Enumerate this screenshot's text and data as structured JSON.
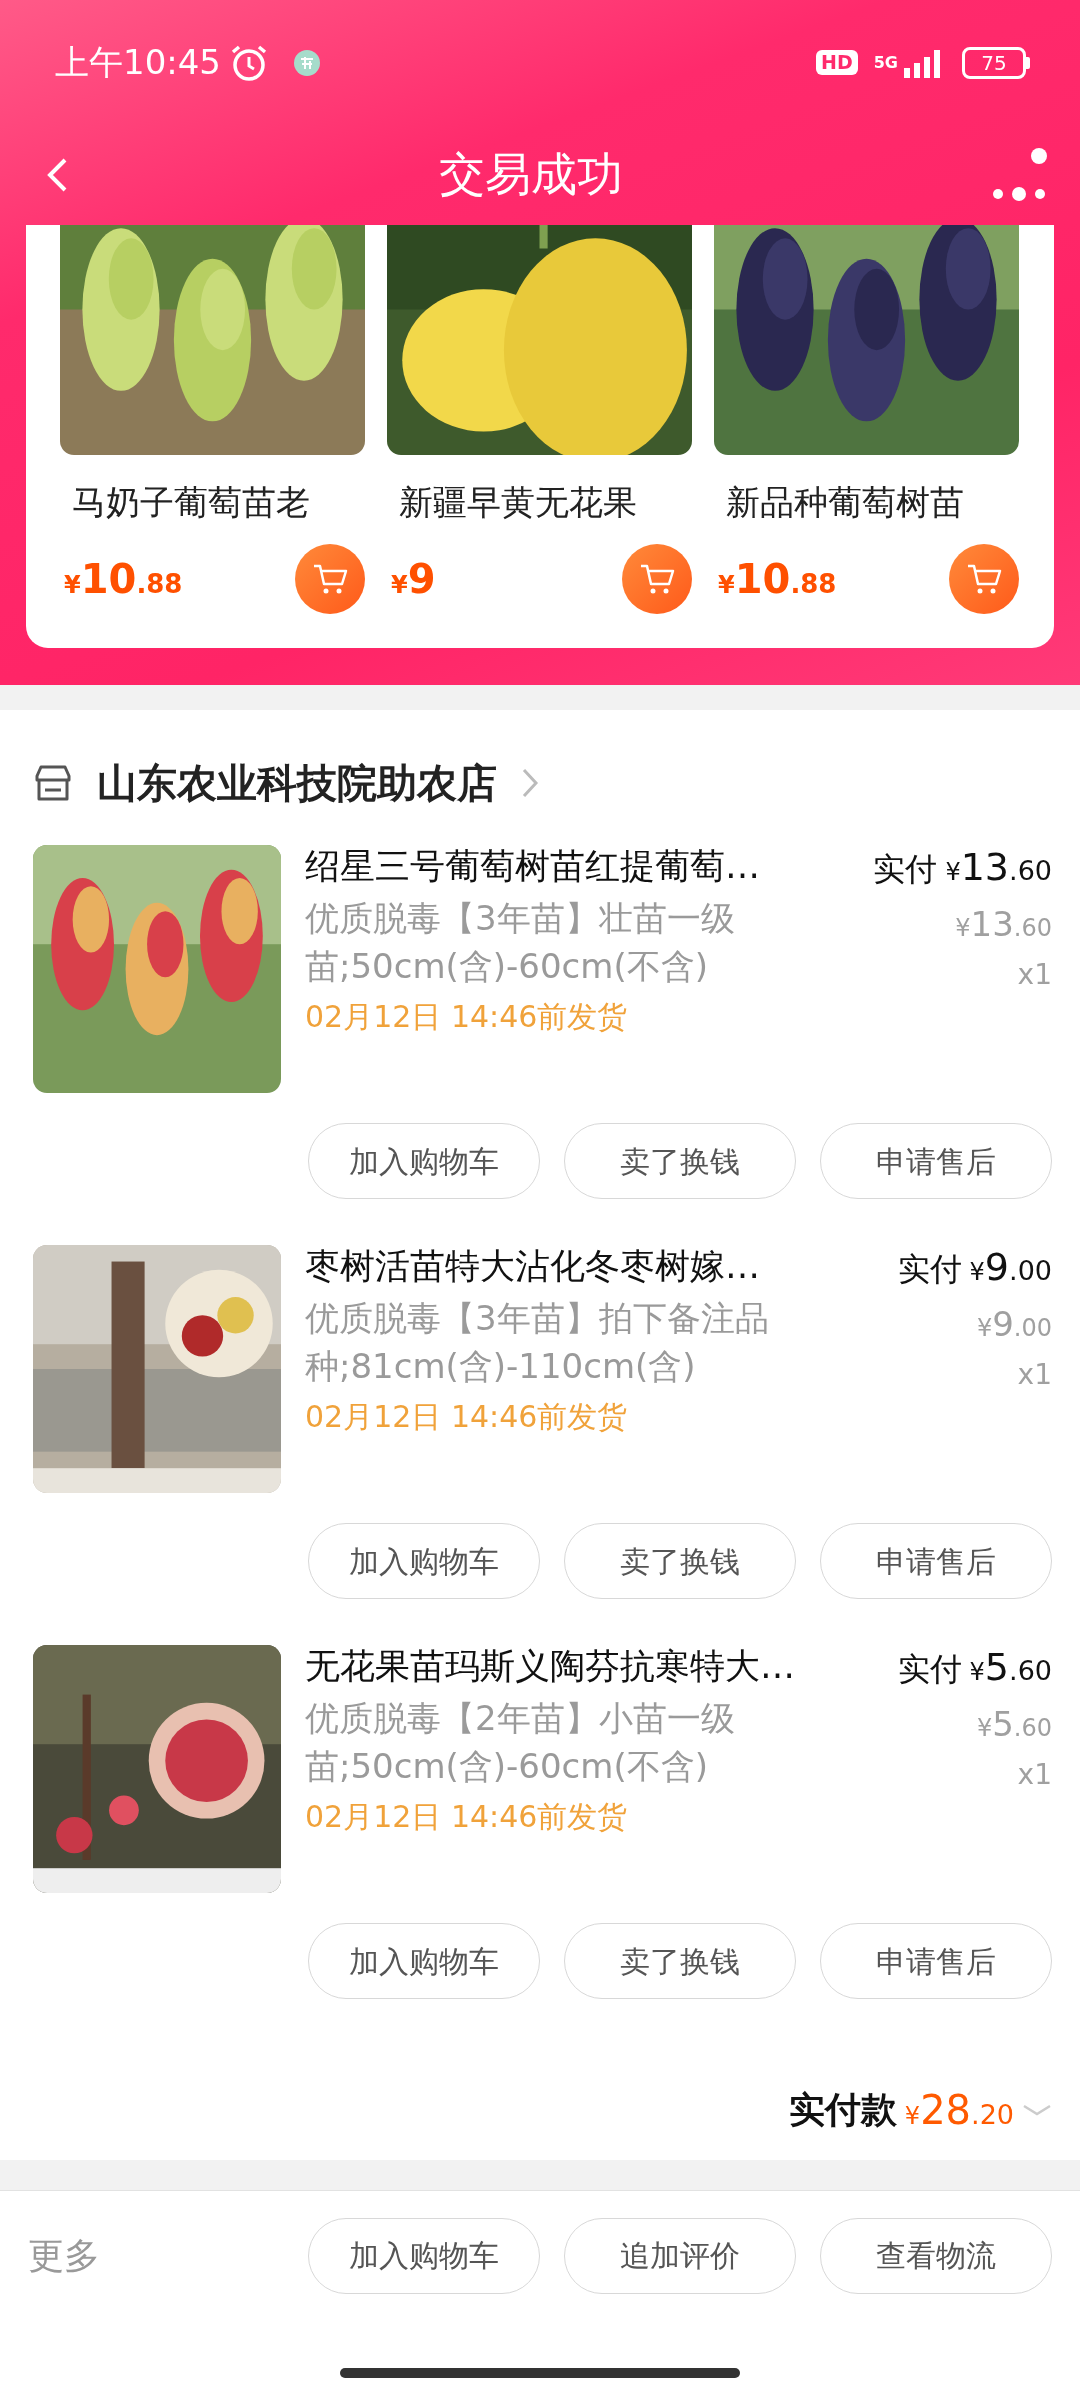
{
  "status_bar": {
    "time": "上午10:45",
    "hd": "HD",
    "network": "5G",
    "battery": "75"
  },
  "header": {
    "title": "交易成功"
  },
  "recommendations": [
    {
      "name": "马奶子葡萄苗老",
      "price": {
        "currency": "¥",
        "amount": "10",
        "fraction": ".88"
      }
    },
    {
      "name": "新疆早黄无花果",
      "price": {
        "currency": "¥",
        "amount": "9"
      }
    },
    {
      "name": "新品种葡萄树苗",
      "price": {
        "currency": "¥",
        "amount": "10",
        "fraction": ".88"
      }
    }
  ],
  "store": {
    "name": "山东农业科技院助农店"
  },
  "orders": [
    {
      "title": "绍星三号葡萄树苗红提葡萄…",
      "paid_label": "实付",
      "paid_price": {
        "currency": "¥",
        "amount": "13",
        "fraction": ".60"
      },
      "unit_price": {
        "currency": "¥",
        "amount": "13",
        "fraction": ".60"
      },
      "quantity": "x1",
      "spec": "优质脱毒【3年苗】壮苗一级苗;50cm(含)-60cm(不含)",
      "shipping": "02月12日 14:46前发货",
      "actions": [
        "加入购物车",
        "卖了换钱",
        "申请售后"
      ]
    },
    {
      "title": "枣树活苗特大沾化冬枣树嫁…",
      "paid_label": "实付",
      "paid_price": {
        "currency": "¥",
        "amount": "9",
        "fraction": ".00"
      },
      "unit_price": {
        "currency": "¥",
        "amount": "9",
        "fraction": ".00"
      },
      "quantity": "x1",
      "spec": "优质脱毒【3年苗】拍下备注品种;81cm(含)-110cm(含)",
      "shipping": "02月12日 14:46前发货",
      "actions": [
        "加入购物车",
        "卖了换钱",
        "申请售后"
      ]
    },
    {
      "title": "无花果苗玛斯义陶芬抗寒特大…",
      "paid_label": "实付",
      "paid_price": {
        "currency": "¥",
        "amount": "5",
        "fraction": ".60"
      },
      "unit_price": {
        "currency": "¥",
        "amount": "5",
        "fraction": ".60"
      },
      "quantity": "x1",
      "spec": "优质脱毒【2年苗】小苗一级苗;50cm(含)-60cm(不含)",
      "shipping": "02月12日 14:46前发货",
      "actions": [
        "加入购物车",
        "卖了换钱",
        "申请售后"
      ]
    }
  ],
  "total": {
    "label": "实付款",
    "price": {
      "currency": "¥",
      "amount": "28",
      "fraction": ".20"
    }
  },
  "bottom_bar": {
    "more": "更多",
    "actions": [
      "加入购物车",
      "追加评价",
      "查看物流"
    ]
  }
}
